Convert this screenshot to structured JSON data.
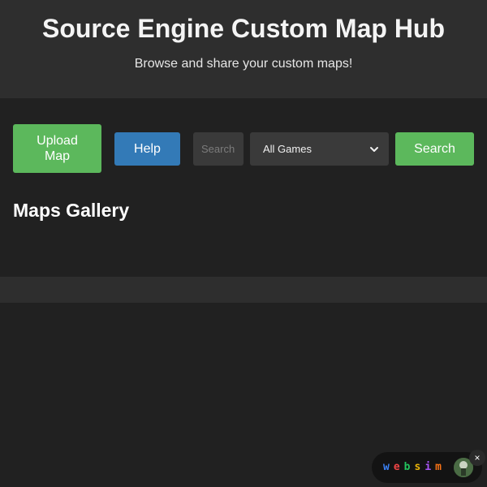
{
  "header": {
    "title": "Source Engine Custom Map Hub",
    "subtitle": "Browse and share your custom maps!"
  },
  "toolbar": {
    "upload_label": "Upload Map",
    "help_label": "Help",
    "search_placeholder": "Search",
    "game_select": {
      "selected": "All Games"
    },
    "search_label": "Search"
  },
  "gallery": {
    "title": "Maps Gallery"
  },
  "badge": {
    "letters": [
      "w",
      "e",
      "b",
      "s",
      "i",
      "m"
    ],
    "close_label": "×"
  },
  "colors": {
    "background": "#212121",
    "header": "#2e2e2e",
    "primary_green": "#5cb85c",
    "help_blue": "#337ab7",
    "input_bg": "#3a3a3a"
  },
  "icons": {
    "select_chevron": "chevron-down-icon",
    "avatar": "avatar-icon",
    "close": "close-icon"
  }
}
